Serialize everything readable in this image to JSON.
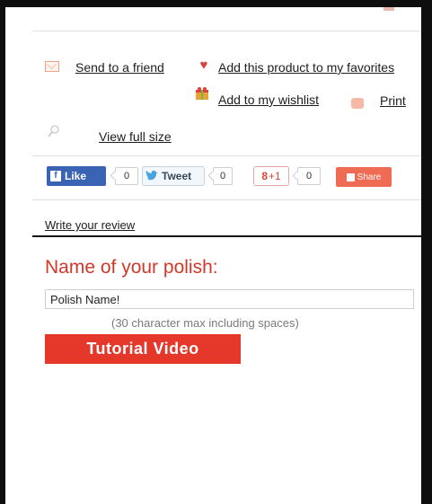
{
  "product_actions": {
    "send_to_friend": "Send to a friend",
    "add_favorites": "Add this product to my favorites",
    "add_wishlist": "Add to my wishlist",
    "print": "Print",
    "view_full_size": "View full size"
  },
  "social": {
    "like_label": "Like",
    "like_count": "0",
    "tweet_label": "Tweet",
    "tweet_count": "0",
    "gplus_label": "+1",
    "gplus_count": "0",
    "share_label": "Share"
  },
  "review": {
    "write_review": "Write your review"
  },
  "polish_form": {
    "heading": "Name of your polish:",
    "input_value": "Polish Name!",
    "hint": "(30 character max including spaces)",
    "tutorial_button": "Tutorial Video"
  },
  "colors": {
    "accent_red": "#d2382a",
    "button_red": "#e6382a",
    "facebook_blue": "#3b63b3",
    "share_orange": "#ef6b53"
  },
  "icons": [
    "mail-icon",
    "heart-icon",
    "gift-icon",
    "print-icon",
    "magnifier-icon",
    "facebook-icon",
    "twitter-bird-icon",
    "share-icon"
  ]
}
